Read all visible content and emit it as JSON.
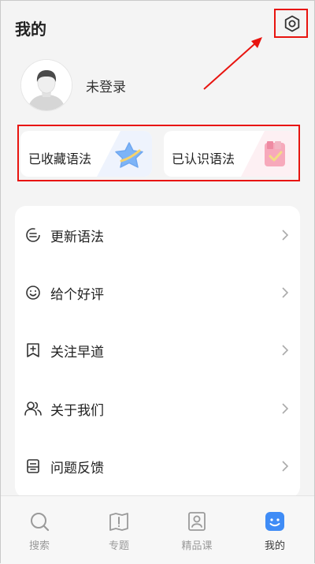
{
  "header": {
    "title": "我的"
  },
  "profile": {
    "username": "未登录"
  },
  "cards": [
    {
      "label": "已收藏语法",
      "icon": "star-icon"
    },
    {
      "label": "已认识语法",
      "icon": "checked-bookmark-icon"
    }
  ],
  "menu": {
    "items": [
      {
        "label": "更新语法",
        "icon": "refresh-icon"
      },
      {
        "label": "给个好评",
        "icon": "smile-icon"
      },
      {
        "label": "关注早道",
        "icon": "add-bookmark-icon"
      },
      {
        "label": "关于我们",
        "icon": "users-icon"
      },
      {
        "label": "问题反馈",
        "icon": "feedback-icon"
      }
    ]
  },
  "tabbar": {
    "tabs": [
      {
        "label": "搜索",
        "icon": "search-icon"
      },
      {
        "label": "专题",
        "icon": "book-icon"
      },
      {
        "label": "精品课",
        "icon": "course-icon"
      },
      {
        "label": "我的",
        "icon": "profile-icon",
        "active": true
      }
    ]
  },
  "colors": {
    "accent": "#3f8cf6",
    "highlight": "#e8140f",
    "background": "#f4f4f4"
  }
}
